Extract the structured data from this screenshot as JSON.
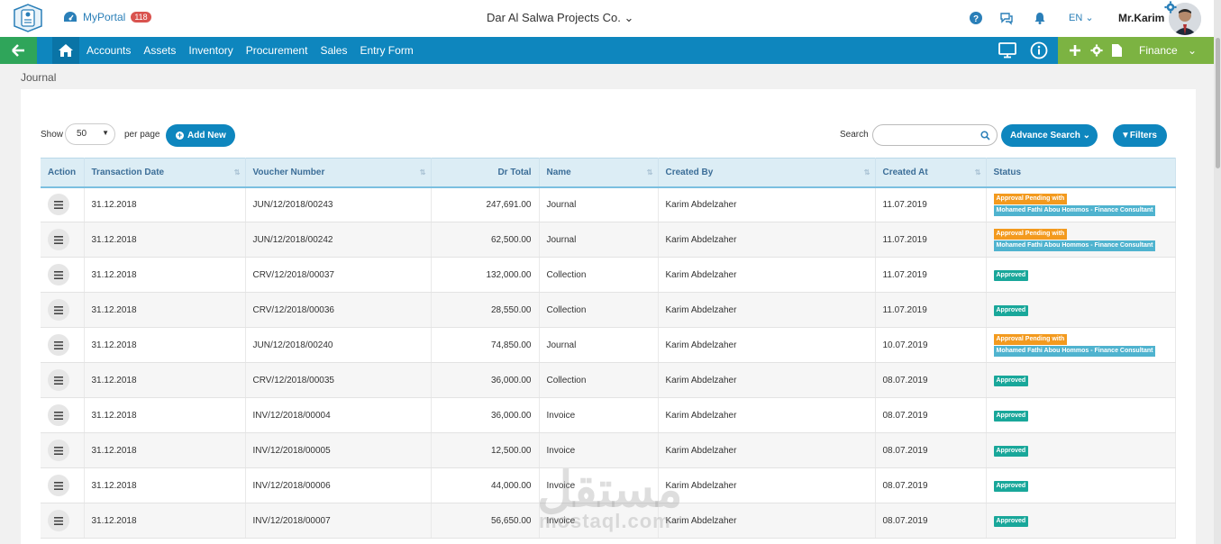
{
  "app": {
    "portal_label": "MyPortal",
    "notification_count": "118",
    "company": "Dar Al Salwa Projects Co.",
    "language": "EN",
    "user_name": "Mr.Karim"
  },
  "nav": {
    "items": [
      "Accounts",
      "Assets",
      "Inventory",
      "Procurement",
      "Sales",
      "Entry Form"
    ],
    "module": "Finance"
  },
  "page": {
    "breadcrumb": "Journal",
    "show_label": "Show",
    "per_page_value": "50",
    "per_page_label": "per page",
    "add_new": "Add New",
    "search_label": "Search",
    "advance_search": "Advance Search",
    "filters": "Filters"
  },
  "table": {
    "headers": [
      "Action",
      "Transaction Date",
      "Voucher Number",
      "Dr Total",
      "Name",
      "Created By",
      "Created At",
      "Status"
    ],
    "rows": [
      {
        "date": "31.12.2018",
        "voucher": "JUN/12/2018/00243",
        "total": "247,691.00",
        "name": "Journal",
        "by": "Karim Abdelzaher",
        "at": "11.07.2019",
        "status": "pending"
      },
      {
        "date": "31.12.2018",
        "voucher": "JUN/12/2018/00242",
        "total": "62,500.00",
        "name": "Journal",
        "by": "Karim Abdelzaher",
        "at": "11.07.2019",
        "status": "pending"
      },
      {
        "date": "31.12.2018",
        "voucher": "CRV/12/2018/00037",
        "total": "132,000.00",
        "name": "Collection",
        "by": "Karim Abdelzaher",
        "at": "11.07.2019",
        "status": "approved"
      },
      {
        "date": "31.12.2018",
        "voucher": "CRV/12/2018/00036",
        "total": "28,550.00",
        "name": "Collection",
        "by": "Karim Abdelzaher",
        "at": "11.07.2019",
        "status": "approved"
      },
      {
        "date": "31.12.2018",
        "voucher": "JUN/12/2018/00240",
        "total": "74,850.00",
        "name": "Journal",
        "by": "Karim Abdelzaher",
        "at": "10.07.2019",
        "status": "pending"
      },
      {
        "date": "31.12.2018",
        "voucher": "CRV/12/2018/00035",
        "total": "36,000.00",
        "name": "Collection",
        "by": "Karim Abdelzaher",
        "at": "08.07.2019",
        "status": "approved"
      },
      {
        "date": "31.12.2018",
        "voucher": "INV/12/2018/00004",
        "total": "36,000.00",
        "name": "Invoice",
        "by": "Karim Abdelzaher",
        "at": "08.07.2019",
        "status": "approved"
      },
      {
        "date": "31.12.2018",
        "voucher": "INV/12/2018/00005",
        "total": "12,500.00",
        "name": "Invoice",
        "by": "Karim Abdelzaher",
        "at": "08.07.2019",
        "status": "approved"
      },
      {
        "date": "31.12.2018",
        "voucher": "INV/12/2018/00006",
        "total": "44,000.00",
        "name": "Invoice",
        "by": "Karim Abdelzaher",
        "at": "08.07.2019",
        "status": "approved"
      },
      {
        "date": "31.12.2018",
        "voucher": "INV/12/2018/00007",
        "total": "56,650.00",
        "name": "Invoice",
        "by": "Karim Abdelzaher",
        "at": "08.07.2019",
        "status": "approved"
      }
    ],
    "status_labels": {
      "pending": "Approval Pending with",
      "pending_person": "Mohamed Fathi Abou Hommos - Finance Consultant",
      "approved": "Approved"
    }
  },
  "watermark": {
    "arabic": "مستقل",
    "latin": "mostaql.com"
  },
  "colors": {
    "primary": "#0e86be",
    "green": "#2fa55a",
    "finance": "#7cb342",
    "pending": "#f39a1e",
    "consultant": "#4fb3cf",
    "approved": "#19a79a"
  }
}
